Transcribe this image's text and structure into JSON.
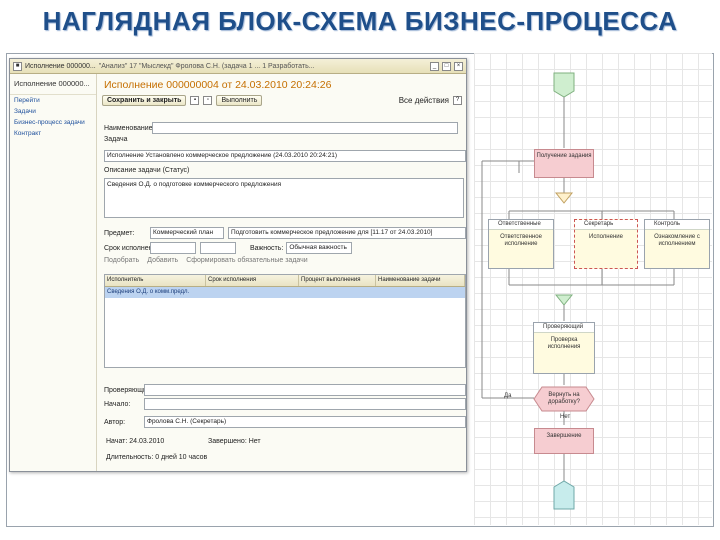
{
  "slide": {
    "title": "НАГЛЯДНАЯ БЛОК-СХЕМА БИЗНЕС-ПРОЦЕССА"
  },
  "window": {
    "title_left": "Исполнение 000000...",
    "title_path": "\"Анализ\" 17 \"Мыслекд\" Фролова С.Н. (задача 1 ... 1 Разработать...",
    "controls": [
      "_",
      "□",
      "×"
    ]
  },
  "sidebar": {
    "header": "Исполнение 000000...",
    "items": [
      "Перейти",
      "Задачи",
      "Бизнес-процесс задачи",
      "Контракт"
    ]
  },
  "document": {
    "title": "Исполнение 000000004 от 24.03.2010 20:24:26",
    "toolbar": {
      "save_close": "Сохранить и закрыть",
      "execute": "Выполнить",
      "more": "Все действия"
    },
    "fields": {
      "name_label": "Наименование",
      "task_label": "Задача",
      "task_value": "Исполнение Установлено коммерческое предложение (24.03.2010 20:24:21)",
      "description_label": "Описание задачи (Статус)",
      "description_value": "Сведения О.Д. о подготовке коммерческого предложения",
      "subject_label": "Предмет:",
      "subject_value": "Коммерческий план",
      "subject_extra": "Подготовить коммерческое предложение для [11.17 от 24.03.2010]",
      "term_label": "Срок исполнения:",
      "term_value": "",
      "importance_label": "Важность:",
      "importance_value": "Обычная важность"
    },
    "subtabs": [
      "Подобрать",
      "Добавить",
      "Сформировать обязательные задачи"
    ],
    "table": {
      "headers": [
        "Исполнитель",
        "Срок исполнения",
        "Процент выполнения",
        "Наименование задачи"
      ],
      "row": [
        "Сведения О.Д. о комм.предл."
      ]
    },
    "footer": {
      "reviewer_label": "Проверяющий:",
      "deadline_label": "Начало:",
      "author_label": "Автор:",
      "author_value": "Фролова С.Н. (Секретарь)",
      "start_label": "Начат: 24.03.2010",
      "completed_label": "Завершено: Нет",
      "duration_label": "Длительность: 0 дней 10 часов"
    }
  },
  "flowchart": {
    "start_label": "",
    "node1": "Получение задания",
    "col_left_head": "Ответственные",
    "col_left_body": "Ответственное исполнение",
    "col_mid_head": "Секретарь",
    "col_mid_body": "Исполнение",
    "col_right_head": "Контроль",
    "col_right_body": "Ознакомление с исполнением",
    "check_head": "Проверяющий",
    "check_body": "Проверка исполнения",
    "decision": "Вернуть на доработку?",
    "yes_label": "Да",
    "no_label": "Нет",
    "end_node": "Завершение"
  }
}
